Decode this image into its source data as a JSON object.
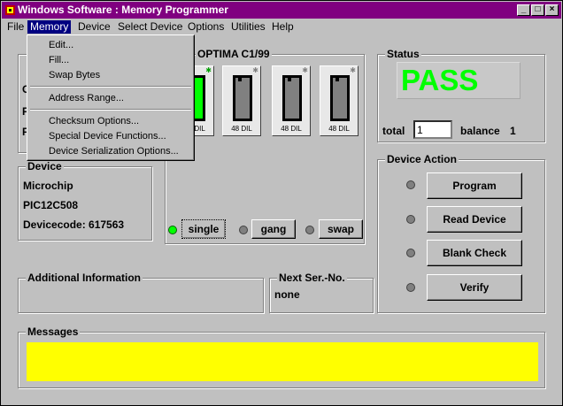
{
  "window": {
    "title": "Windows Software : Memory Programmer",
    "minimize": "_",
    "maximize": "□",
    "close": "×"
  },
  "menubar": [
    "File",
    "Memory",
    "Device",
    "Select Device",
    "Options",
    "Utilities",
    "Help"
  ],
  "memory_menu": {
    "items": [
      "Edit...",
      "Fill...",
      "Swap Bytes",
      "Address Range...",
      "Checksum Options...",
      "Special Device Functions...",
      "Device Serialization Options..."
    ]
  },
  "programmer": {
    "title": "OPTIMA  C1/99",
    "sockets": [
      {
        "label": "48 DIL",
        "active": true
      },
      {
        "label": "48 DIL",
        "active": false
      },
      {
        "label": "48 DIL",
        "active": false
      },
      {
        "label": "48 DIL",
        "active": false
      }
    ],
    "modes": [
      "single",
      "gang",
      "swap"
    ]
  },
  "hidden_group_labels": [
    "C",
    "F",
    "F"
  ],
  "device": {
    "legend": "Device",
    "manufacturer": "Microchip",
    "part": "PIC12C508",
    "code": "Devicecode: 617563"
  },
  "status": {
    "legend": "Status",
    "result": "PASS",
    "total_label": "total",
    "total_value": "1",
    "balance_label": "balance",
    "balance_value": "1"
  },
  "device_action": {
    "legend": "Device Action",
    "buttons": [
      "Program",
      "Read Device",
      "Blank Check",
      "Verify"
    ]
  },
  "additional_info": {
    "legend": "Additional Information"
  },
  "next_serial": {
    "legend": "Next Ser.-No.",
    "value": "none"
  },
  "messages": {
    "legend": "Messages"
  },
  "colors": {
    "title_bar": "#800080",
    "menu_highlight": "#000080",
    "pass_text": "#00ff00",
    "messages_bg": "#ffff00",
    "led_on": "#00ff00"
  }
}
